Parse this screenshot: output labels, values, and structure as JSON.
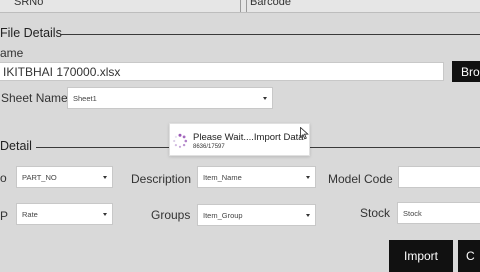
{
  "grid_header": {
    "col1": "SRNo",
    "col2": "Barcode"
  },
  "file_details": {
    "title": "File Details",
    "name_label": "ame",
    "file_value": "IKITBHAI 170000.xlsx",
    "browse_label": "Bro",
    "sheet_label": "Sheet Name",
    "sheet_value": "Sheet1"
  },
  "detail": {
    "title": "Detail",
    "row1_partial_label": "o",
    "part_no_value": "PART_NO",
    "description_label": "Description",
    "description_value": "Item_Name",
    "model_code_label": "Model Code",
    "row2_partial_label": "P",
    "rate_value": "Rate",
    "groups_label": "Groups",
    "groups_value": "Item_Group",
    "stock_label": "Stock",
    "stock_value": "Stock"
  },
  "popup": {
    "title": "Please Wait....Import Data",
    "progress": "8636/17597"
  },
  "buttons": {
    "import_label": "Import",
    "second_label": "C"
  },
  "colors": {
    "accent_spinner": "#9b59b6",
    "dark_button": "#111111",
    "background": "#d9d9d9"
  },
  "icons": {
    "spinner": "loading-spinner-icon",
    "cursor": "mouse-pointer-icon",
    "caret": "chevron-down-icon"
  }
}
